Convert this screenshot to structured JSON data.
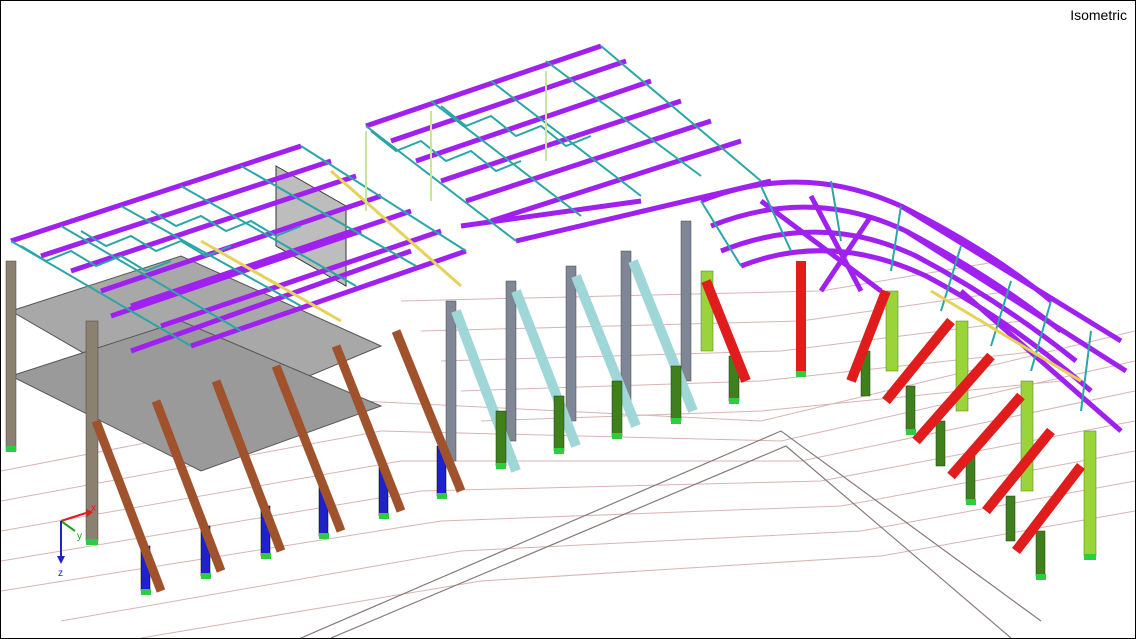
{
  "view": {
    "label": "Isometric"
  },
  "axes": {
    "x": "x",
    "y": "y",
    "z": "z"
  },
  "colors": {
    "background": "#ffffff",
    "wireframe": "#d9b3b3",
    "roof_beam": "#a020f0",
    "truss": "#2aa6a6",
    "yellow_beam": "#e6d25a",
    "brown_column": "#a0522d",
    "blue_column": "#1e22c8",
    "cyan_column": "#9fd7d9",
    "grey_column": "#7f8796",
    "green_column": "#3f7f1e",
    "lime_column": "#9ad43a",
    "red_column": "#e01c1c",
    "slab": "#9c9c9c",
    "support": "#2ecc40"
  },
  "icons": [
    "axis-triad-icon"
  ]
}
